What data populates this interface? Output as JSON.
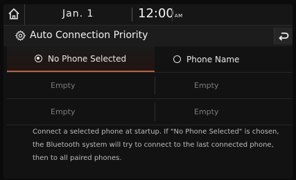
{
  "status_bar": {
    "date": "Jan.  1",
    "time": "12:00",
    "ampm": "AM"
  },
  "header": {
    "title": "Auto Connection Priority"
  },
  "options": {
    "no_phone_selected": "No Phone Selected",
    "phone_name": "Phone Name"
  },
  "slots": [
    "Empty",
    "Empty",
    "Empty",
    "Empty"
  ],
  "description": "Connect a selected phone at startup. If \"No Phone Selected\" is chosen, the Bluetooth system will try to connect to the last connected phone, then to all paired phones.",
  "colors": {
    "accent": "#d45a2a"
  },
  "icons": {
    "home": "home-icon",
    "settings": "gear-icon",
    "back": "back-icon"
  }
}
